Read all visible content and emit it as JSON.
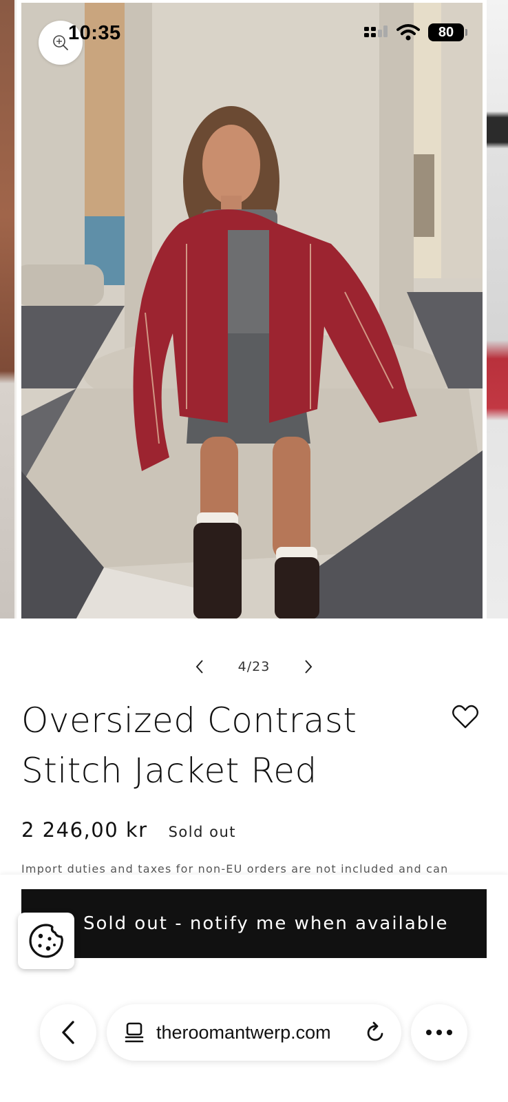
{
  "status_bar": {
    "time": "10:35",
    "battery_level": "80",
    "icons": [
      "cellular-signal-icon",
      "wifi-icon",
      "battery-icon"
    ]
  },
  "gallery": {
    "zoom_icon": "zoom-in-icon",
    "current": "4",
    "total": "23",
    "counter": "4/23",
    "prev_icon": "chevron-left-icon",
    "next_icon": "chevron-right-icon"
  },
  "product": {
    "title": "Oversized Contrast Stitch Jacket Red",
    "price": "2 246,00 kr",
    "availability": "Sold out",
    "disclaimer": "Import duties and taxes for non-EU orders are not included and can",
    "wishlist_icon": "heart-icon"
  },
  "actions": {
    "notify_label": "Sold out - notify me when available",
    "cookie_icon": "cookie-icon"
  },
  "browser": {
    "url": "theroomantwerp.com",
    "back_icon": "chevron-left-icon",
    "page_icon": "page-menu-icon",
    "reload_icon": "reload-icon",
    "more_icon": "more-dots-icon"
  },
  "colors": {
    "button_background": "#111111",
    "jacket_red": "#9c2430",
    "page_background": "#ffffff"
  }
}
